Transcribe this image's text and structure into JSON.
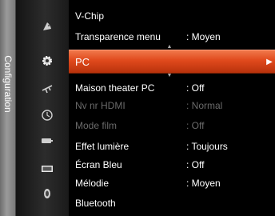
{
  "sidebar": {
    "title": "Configuration"
  },
  "icons": [
    "satellite-dish-icon",
    "gear-icon",
    "antenna-icon",
    "clock-icon",
    "input-source-icon",
    "picture-icon",
    "sound-icon"
  ],
  "menu": {
    "items": [
      {
        "label": "V-Chip",
        "value": "",
        "disabled": false
      },
      {
        "label": "Transparence menu",
        "value": ": Moyen",
        "disabled": false
      },
      {
        "label": "PC",
        "value": "",
        "selected": true
      },
      {
        "label": "Maison theater PC",
        "value": ": Off",
        "disabled": false
      },
      {
        "label": "Nv nr HDMI",
        "value": ": Normal",
        "disabled": true
      },
      {
        "label": "Mode film",
        "value": ": Off",
        "disabled": true
      },
      {
        "label": "Effet lumière",
        "value": ": Toujours",
        "disabled": false
      },
      {
        "label": "Écran Bleu",
        "value": ": Off",
        "disabled": false
      },
      {
        "label": "Mélodie",
        "value": ": Moyen",
        "disabled": false
      },
      {
        "label": "Bluetooth",
        "value": "",
        "disabled": false
      }
    ],
    "selected_arrow": "▶",
    "scroll_up": "▲",
    "scroll_down": "▼"
  },
  "colors": {
    "highlight": "#e0491c",
    "text": "#ffffff",
    "disabled_text": "#6a6a6a",
    "background": "#000000"
  }
}
